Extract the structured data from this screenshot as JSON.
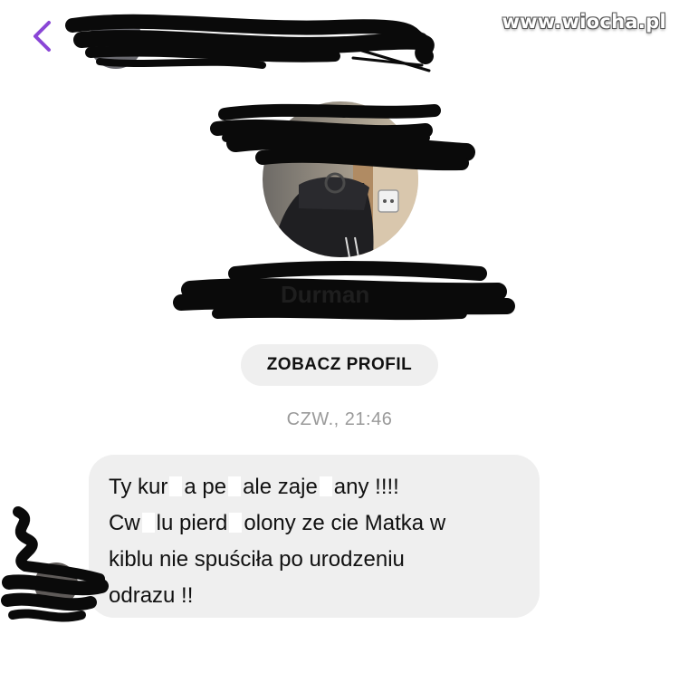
{
  "header": {
    "back_icon": "chevron-left-icon",
    "accent_color": "#8a46d6"
  },
  "watermark": {
    "text": "www.wiocha.pl"
  },
  "profile": {
    "view_profile_label": "ZOBACZ PROFIL"
  },
  "thread": {
    "timestamp": "CZW., 21:46",
    "message": {
      "line1": {
        "a": "Ty kur",
        "b": "a pe",
        "c": "ale  zaje",
        "d": "any !!!!"
      },
      "line2": {
        "a": "Cw",
        "b": "lu pierd",
        "c": "olony   ze cie Matka w"
      },
      "line3": "kiblu nie spuściła  po urodzeniu",
      "line4": "odrazu !!"
    }
  }
}
